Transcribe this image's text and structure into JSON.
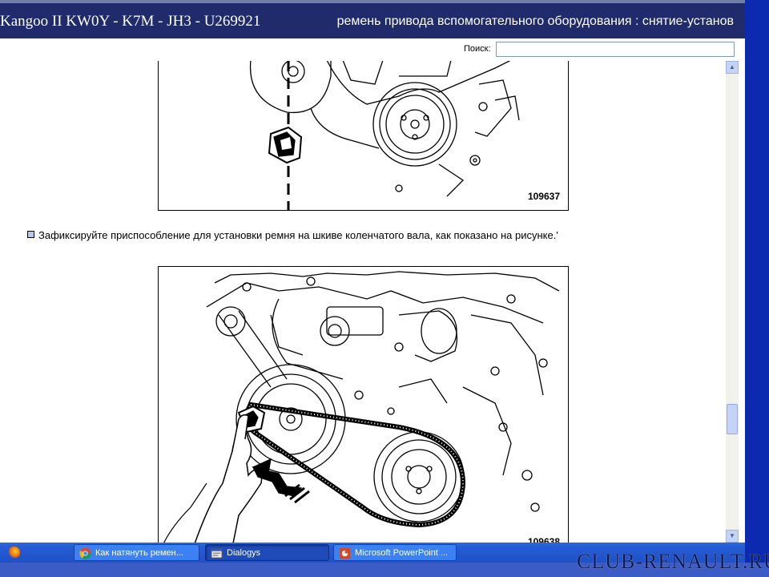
{
  "window": {
    "title_left": "Kangoo II KW0Y - K7M - JH3 - U269921",
    "title_right": "ремень привода вспомогательного оборудования : снятие-установ"
  },
  "search": {
    "label": "Поиск:",
    "value": ""
  },
  "content": {
    "figure1_number": "109637",
    "instruction": "Зафиксируйте приспособление для установки ремня на шкиве коленчатого вала, как показано на рисунке.'",
    "figure2_number": "109638"
  },
  "taskbar": {
    "items": [
      {
        "label": "Как натянуть ремен...",
        "icon": "chrome-icon"
      },
      {
        "label": "Dialogys",
        "icon": "app-window-icon"
      },
      {
        "label": "Microsoft PowerPoint ...",
        "icon": "powerpoint-icon"
      }
    ],
    "quicklaunch": [
      "firefox-icon"
    ]
  },
  "watermark": "CLUB-RENAULT.RU",
  "colors": {
    "titlebar": "#1f2b6b",
    "taskbar": "#245dd6",
    "side_panel": "#0b2ab0"
  }
}
